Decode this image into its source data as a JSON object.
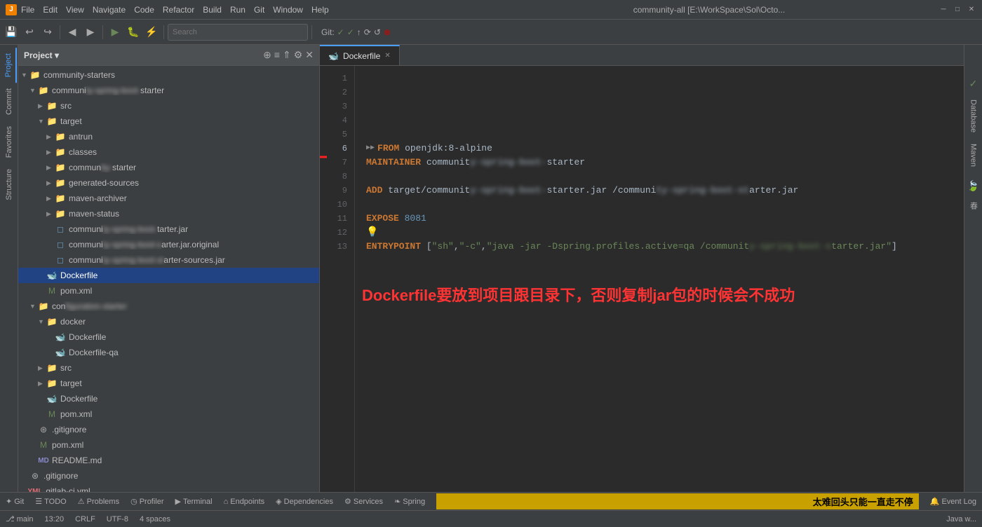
{
  "titlebar": {
    "app_icon": "J",
    "menu_items": [
      "File",
      "Edit",
      "View",
      "Navigate",
      "Code",
      "Refactor",
      "Build",
      "Run",
      "Git",
      "Window",
      "Help"
    ],
    "title": "community-all [E:\\WorkSpace\\Sol\\Octo...",
    "minimize": "🗕",
    "maximize": "🗖",
    "close": "✕"
  },
  "toolbar": {
    "search_placeholder": "",
    "git_label": "Git:"
  },
  "project_panel": {
    "title": "Project",
    "tree": [
      {
        "id": "community-starters",
        "label": "community-starters",
        "type": "folder",
        "depth": 0,
        "expanded": true
      },
      {
        "id": "communi-starter",
        "label": "communi",
        "label_blur": "ity-",
        "label_suffix": "starter",
        "type": "folder",
        "depth": 1,
        "expanded": true
      },
      {
        "id": "src",
        "label": "src",
        "type": "folder",
        "depth": 2,
        "expanded": false
      },
      {
        "id": "target",
        "label": "target",
        "type": "folder",
        "depth": 2,
        "expanded": true
      },
      {
        "id": "antrun",
        "label": "antrun",
        "type": "folder",
        "depth": 3,
        "expanded": false
      },
      {
        "id": "classes",
        "label": "classes",
        "type": "folder",
        "depth": 3,
        "expanded": false
      },
      {
        "id": "commun-starter2",
        "label": "commun",
        "label_blur": "ity-",
        "label_suffix": "starter",
        "type": "folder",
        "depth": 3,
        "expanded": false
      },
      {
        "id": "generated-sources",
        "label": "generated-sources",
        "type": "folder",
        "depth": 3,
        "expanded": false
      },
      {
        "id": "maven-archiver",
        "label": "maven-archiver",
        "type": "folder",
        "depth": 3,
        "expanded": false
      },
      {
        "id": "maven-status",
        "label": "maven-status",
        "type": "folder",
        "depth": 3,
        "expanded": false
      },
      {
        "id": "jar1",
        "label": "communi",
        "label_blur": "ty-spring-boot-",
        "label_suffix": "tarter.jar",
        "type": "jar",
        "depth": 3
      },
      {
        "id": "jar2",
        "label": "communi",
        "label_blur": "ty-spring-boot-s",
        "label_suffix": "arter.jar.original",
        "type": "jar",
        "depth": 3
      },
      {
        "id": "jar3",
        "label": "communi",
        "label_blur": "ty-spring-boot-st",
        "label_suffix": "arter-sources.jar",
        "type": "jar",
        "depth": 3
      },
      {
        "id": "dockerfile1",
        "label": "Dockerfile",
        "type": "docker",
        "depth": 2,
        "selected": true
      },
      {
        "id": "pom1",
        "label": "pom.xml",
        "type": "xml",
        "depth": 2
      },
      {
        "id": "con-folder",
        "label": "con",
        "label_blur": "figuration-starter",
        "type": "folder",
        "depth": 1,
        "expanded": true
      },
      {
        "id": "docker-folder",
        "label": "docker",
        "type": "folder",
        "depth": 2,
        "expanded": true
      },
      {
        "id": "dockerfile2",
        "label": "Dockerfile",
        "type": "docker",
        "depth": 3
      },
      {
        "id": "dockerfile-qa",
        "label": "Dockerfile-qa",
        "type": "docker",
        "depth": 3
      },
      {
        "id": "src2",
        "label": "src",
        "type": "folder",
        "depth": 2,
        "expanded": false
      },
      {
        "id": "target2",
        "label": "target",
        "type": "folder",
        "depth": 2,
        "expanded": false
      },
      {
        "id": "dockerfile3",
        "label": "Dockerfile",
        "type": "docker",
        "depth": 2
      },
      {
        "id": "pom2",
        "label": "pom.xml",
        "type": "xml",
        "depth": 2
      },
      {
        "id": "gitignore1",
        "label": ".gitignore",
        "type": "git",
        "depth": 1
      },
      {
        "id": "pom3",
        "label": "pom.xml",
        "type": "xml",
        "depth": 1
      },
      {
        "id": "readme",
        "label": "README.md",
        "type": "md",
        "depth": 1
      },
      {
        "id": "gitignore2",
        "label": ".gitignore",
        "type": "git",
        "depth": 0
      },
      {
        "id": "gitlab",
        "label": ".gitlab-ci.yml",
        "type": "yaml",
        "depth": 0
      }
    ]
  },
  "editor": {
    "tabs": [
      {
        "id": "dockerfile-tab",
        "label": "Dockerfile",
        "active": true,
        "icon": "docker"
      }
    ],
    "lines": [
      {
        "num": 1,
        "content": ""
      },
      {
        "num": 2,
        "content": ""
      },
      {
        "num": 3,
        "content": ""
      },
      {
        "num": 4,
        "content": ""
      },
      {
        "num": 5,
        "content": ""
      },
      {
        "num": 6,
        "content": "FROM openjdk:8-alpine"
      },
      {
        "num": 7,
        "content": "MAINTAINER communit__blur__y-spring-boot-s__blur__tarter"
      },
      {
        "num": 8,
        "content": ""
      },
      {
        "num": 9,
        "content": "ADD target/communit__blur__y-spring-boot-s__blur__tarter.jar /communi__blur__ty-spring-boot-st__blur__tarter.jar"
      },
      {
        "num": 10,
        "content": ""
      },
      {
        "num": 11,
        "content": "EXPOSE 8081"
      },
      {
        "num": 12,
        "content": ""
      },
      {
        "num": 13,
        "content": "ENTRYPOINT [\"sh\",\"-c\",\"java -jar -Dspring.profiles.active=qa /communit__blur__y-spring-boot-s__blur__tarter.jar\"]"
      }
    ]
  },
  "annotation": {
    "text": "Dockerfile要放到项目跟目录下，否则复制jar包的时候会不成功"
  },
  "right_sidebar": {
    "tabs": [
      "Database",
      "Maven",
      "春(Chinese)"
    ]
  },
  "status_bar": {
    "line_col": "13:20",
    "crlf": "CRLF",
    "encoding": "UTF-8",
    "indent": "4 spaces",
    "branch": "main",
    "lang": "Java w..."
  },
  "bottom_bar": {
    "items": [
      {
        "id": "git",
        "icon": "✦",
        "label": "Git"
      },
      {
        "id": "todo",
        "icon": "☰",
        "label": "TODO"
      },
      {
        "id": "problems",
        "icon": "⚠",
        "label": "Problems"
      },
      {
        "id": "profiler",
        "icon": "◷",
        "label": "Profiler"
      },
      {
        "id": "terminal",
        "icon": "▶",
        "label": "Terminal"
      },
      {
        "id": "endpoints",
        "icon": "⌂",
        "label": "Endpoints"
      },
      {
        "id": "dependencies",
        "icon": "◈",
        "label": "Dependencies"
      },
      {
        "id": "services",
        "icon": "⚙",
        "label": "Services"
      },
      {
        "id": "spring",
        "icon": "❧",
        "label": "Spring"
      }
    ],
    "event_log": "Event Log",
    "marquee_text": "太难回头只能一直走不停"
  }
}
